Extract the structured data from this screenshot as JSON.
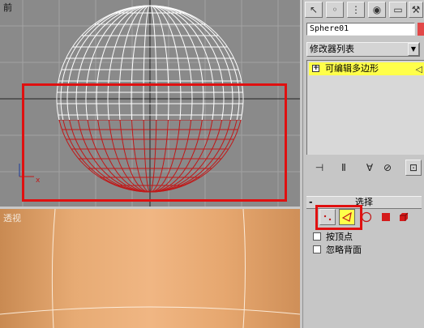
{
  "viewports": {
    "front": {
      "label": "前"
    },
    "perspective": {
      "label": "透视"
    }
  },
  "axis": {
    "x_label": "x"
  },
  "command_panel": {
    "object_name": "Sphere01",
    "object_color": "#e24848",
    "modifier_list_label": "修改器列表",
    "stack": [
      {
        "expander": "+",
        "label": "可编辑多边形",
        "selected": true
      }
    ],
    "selection_rollout": {
      "header": "选择",
      "collapse_symbol": "-",
      "subobject_levels": [
        "vertex-icon",
        "edge-icon",
        "border-icon",
        "polygon-icon",
        "element-icon"
      ],
      "active_level": "edge-icon",
      "checkboxes": [
        {
          "label": "按顶点",
          "checked": false
        },
        {
          "label": "忽略背面",
          "checked": false
        }
      ]
    }
  },
  "colors": {
    "highlight_frame": "#e01010",
    "selected_faces": "#c01818",
    "wireframe": "#ffffff",
    "stack_highlight": "#ffff4a"
  }
}
